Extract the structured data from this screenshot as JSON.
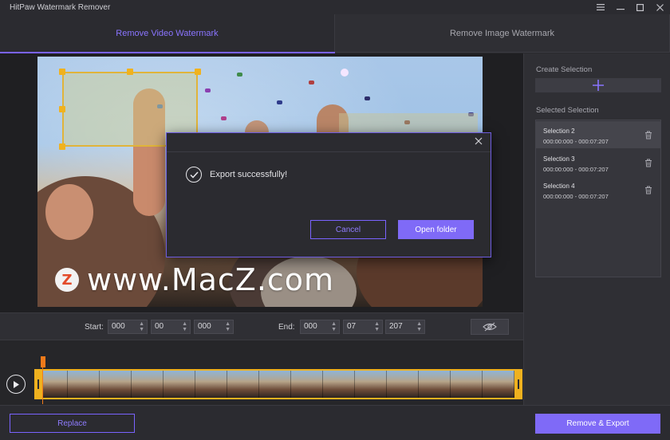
{
  "app": {
    "title": "HitPaw Watermark Remover"
  },
  "window_controls": {
    "menu_icon": "menu-icon",
    "minimize_icon": "minimize-icon",
    "maximize_icon": "maximize-icon",
    "close_icon": "close-icon"
  },
  "tabs": [
    {
      "label": "Remove Video Watermark",
      "active": true
    },
    {
      "label": "Remove Image Watermark",
      "active": false
    }
  ],
  "watermark_overlay": {
    "logo_letter": "Z",
    "text": "www.MacZ.com"
  },
  "dialog": {
    "message": "Export successfully!",
    "cancel_label": "Cancel",
    "open_label": "Open folder"
  },
  "time_controls": {
    "start_label": "Start:",
    "start": [
      "000",
      "00",
      "000"
    ],
    "end_label": "End:",
    "end": [
      "000",
      "07",
      "207"
    ]
  },
  "right_panel": {
    "create_label": "Create Selection",
    "selected_label": "Selected Selection",
    "selections": [
      {
        "name": "Selection 2",
        "range": "000:00:000 - 000:07:207",
        "active": true
      },
      {
        "name": "Selection 3",
        "range": "000:00:000 - 000:07:207",
        "active": false
      },
      {
        "name": "Selection 4",
        "range": "000:00:000 - 000:07:207",
        "active": false
      }
    ]
  },
  "bottom": {
    "replace_label": "Replace",
    "export_label": "Remove & Export"
  },
  "colors": {
    "accent": "#7f6af7",
    "highlight": "#efb11f",
    "playhead": "#f07a1a",
    "background": "#2a2a2e"
  }
}
